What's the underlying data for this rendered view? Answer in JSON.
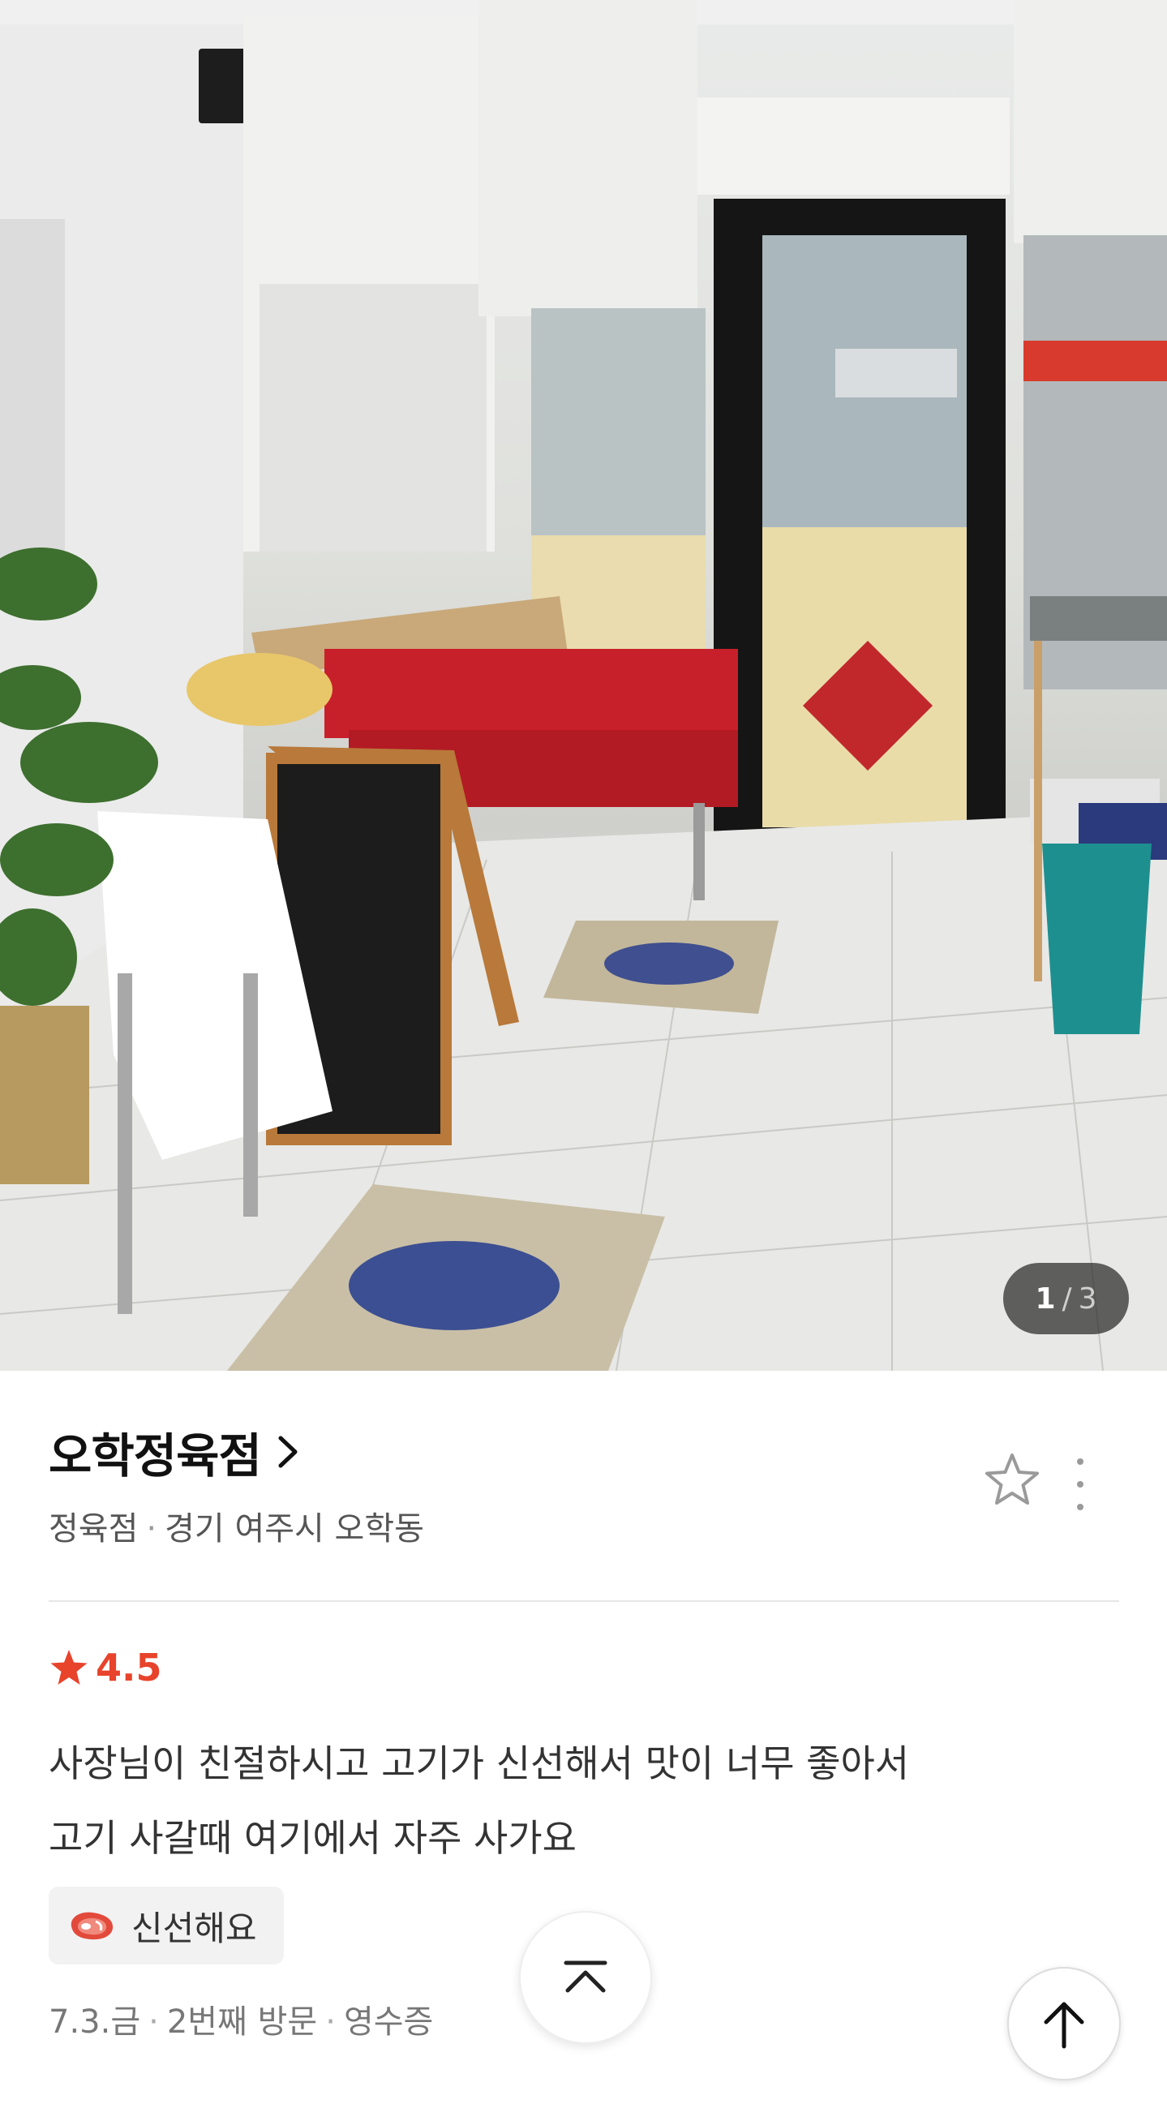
{
  "photo": {
    "counter_current": "1",
    "counter_separator": "/",
    "counter_total": "3",
    "alt": "",
    "icon_colors": {
      "sofa": "#c8202a",
      "bucket": "#1e8f8f",
      "board": "#1c1c1c"
    }
  },
  "place": {
    "name": "오학정육점",
    "category": "정육점",
    "separator": "·",
    "address": "경기 여주시 오학동",
    "icons": {
      "chevron": "chevron-right-icon",
      "favorite": "star-outline-icon",
      "more": "more-vertical-icon"
    }
  },
  "review": {
    "rating": "4.5",
    "rating_color": "#e8432b",
    "text_lines": [
      "사장님이 친절하시고 고기가 신선해서 맛이 너무 좋아서",
      "고기 사갈때 여기에서 자주 사가요"
    ],
    "keyword": "신선해요",
    "keyword_icon": "steak-icon",
    "meta": {
      "date": "7.3.금",
      "visit": "2번째 방문",
      "proof": "영수증",
      "separator": "·"
    }
  },
  "controls": {
    "collapse_icon": "chevron-up-icon",
    "scroll_top_icon": "arrow-up-icon"
  }
}
